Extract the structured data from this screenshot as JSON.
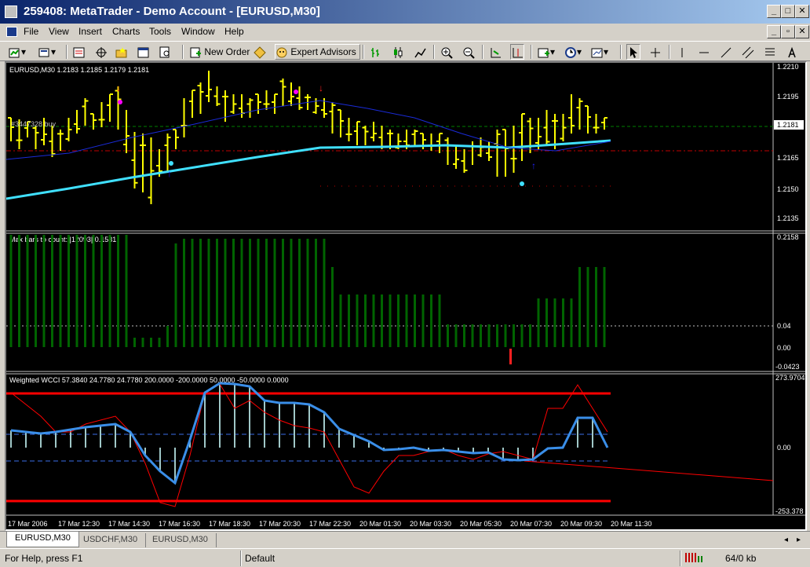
{
  "window": {
    "title": "259408: MetaTrader - Demo Account - [EURUSD,M30]",
    "controls": [
      "_",
      "□",
      "✕"
    ],
    "inner_controls": [
      "_",
      "▫",
      "✕"
    ]
  },
  "menu": [
    "File",
    "View",
    "Insert",
    "Charts",
    "Tools",
    "Window",
    "Help"
  ],
  "toolbar": {
    "new_order_label": "New Order",
    "expert_advisors_label": "Expert Advisors"
  },
  "chart": {
    "symbol_header": "EURUSD,M30  1.2183 1.2185 1.2179 1.2181",
    "order_label": "#3447328 buy",
    "current_price_label": "1.2181",
    "price_axis": [
      "1.2210",
      "1.2195",
      "1.2181",
      "1.2165",
      "1.2150",
      "1.2135"
    ],
    "indicator1_header": "Max bars to count: |12093|  0.1531",
    "indicator1_axis": [
      "0.2158",
      "0.04",
      "0.00",
      "-0.0423"
    ],
    "indicator2_header": "Weighted WCCI 57.3840 24.7780 24.7780 200.0000 -200.0000 50.0000 -50.0000 0.0000",
    "indicator2_axis": [
      "273.9704",
      "0.00",
      "-253.378"
    ],
    "time_axis": [
      "17 Mar 2006",
      "17 Mar 12:30",
      "17 Mar 14:30",
      "17 Mar 16:30",
      "17 Mar 18:30",
      "17 Mar 20:30",
      "17 Mar 22:30",
      "20 Mar 01:30",
      "20 Mar 03:30",
      "20 Mar 05:30",
      "20 Mar 07:30",
      "20 Mar 09:30",
      "20 Mar 11:30"
    ]
  },
  "tabs": [
    "EURUSD,M30",
    "USDCHF,M30",
    "EURUSD,M30"
  ],
  "status": {
    "help": "For Help, press F1",
    "profile": "Default",
    "traffic": "64/0 kb"
  },
  "colors": {
    "bars": "#ffff00",
    "ma_fast": "#1a2bd8",
    "ma_slow": "#40e0ff",
    "histogram": "#006400",
    "wcci": "#3a8ee8",
    "level": "#ff0000",
    "accent_title": "#0a246a"
  }
}
